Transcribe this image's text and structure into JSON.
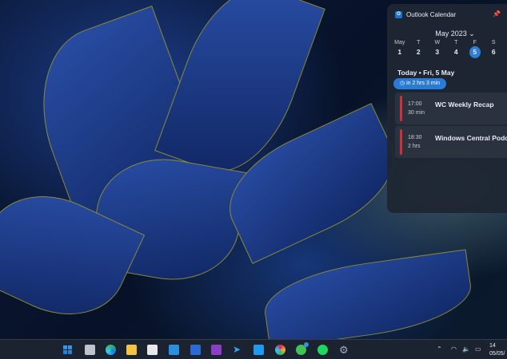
{
  "widget": {
    "title": "Outlook Calendar",
    "month": "May 2023",
    "weekdays": [
      "May",
      "T",
      "W",
      "T",
      "F",
      "S"
    ],
    "dates": [
      "1",
      "2",
      "3",
      "4",
      "5",
      "6"
    ],
    "selected_date": "5",
    "today": "Today • Fri, 5 May",
    "countdown": "in 2 hrs 3 min",
    "events": [
      {
        "time": "17:00",
        "duration": "30 min",
        "name": "WC Weekly Recap"
      },
      {
        "time": "18:30",
        "duration": "2 hrs",
        "name": "Windows Central Podcast"
      }
    ],
    "accent": "#2f7fd8",
    "event_color": "#c8343c"
  },
  "taskbar": {
    "apps": [
      "start",
      "task-view",
      "edge",
      "file-explorer",
      "microsoft-store",
      "mail",
      "word",
      "onenote",
      "telegram",
      "twitter",
      "slack",
      "whatsapp",
      "spotify",
      "settings"
    ],
    "whatsapp_badge": "1",
    "clock_time": "14",
    "clock_date": "05/05/"
  }
}
